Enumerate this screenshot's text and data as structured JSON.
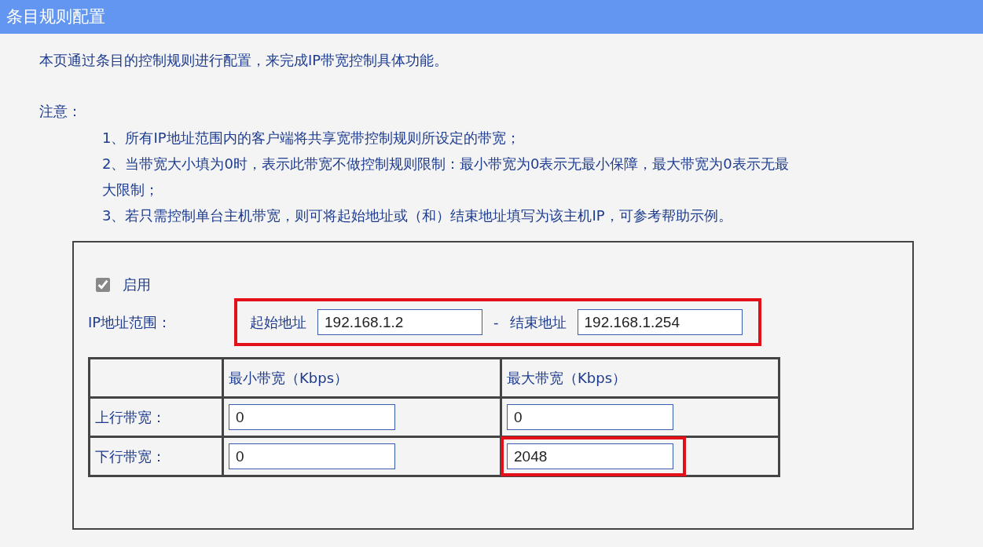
{
  "header": {
    "title": "条目规则配置"
  },
  "intro": "本页通过条目的控制规则进行配置，来完成IP带宽控制具体功能。",
  "notes": {
    "heading": "注意：",
    "items": [
      "1、所有IP地址范围内的客户端将共享宽带控制规则所设定的带宽；",
      "2、当带宽大小填为0时，表示此带宽不做控制规则限制：最小带宽为0表示无最小保障，最大带宽为0表示无最大限制；",
      "3、若只需控制单台主机带宽，则可将起始地址或（和）结束地址填写为该主机IP，可参考帮助示例。"
    ]
  },
  "form": {
    "enable": {
      "label": "启用",
      "checked": true
    },
    "ip_range": {
      "label": "IP地址范围：",
      "highlighted": true,
      "start_label": "起始地址",
      "start_value": "192.168.1.2",
      "separator": "-",
      "end_label": "结束地址",
      "end_value": "192.168.1.254"
    },
    "table": {
      "columns": [
        "最小带宽（Kbps）",
        "最大带宽（Kbps）"
      ],
      "rows": [
        {
          "label": "上行带宽：",
          "values": [
            {
              "value": "0",
              "highlighted": false
            },
            {
              "value": "0",
              "highlighted": false
            }
          ]
        },
        {
          "label": "下行带宽：",
          "values": [
            {
              "value": "0",
              "highlighted": false
            },
            {
              "value": "2048",
              "highlighted": true
            }
          ]
        }
      ]
    }
  }
}
